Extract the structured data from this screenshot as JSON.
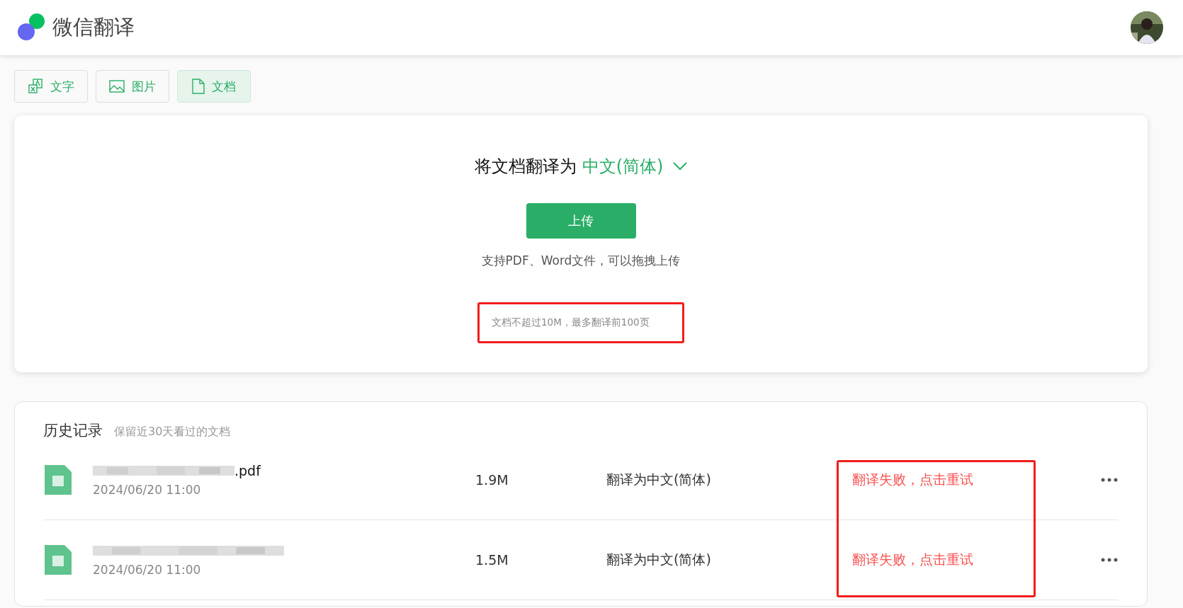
{
  "header": {
    "title": "微信翻译"
  },
  "tabs": [
    {
      "label": "文字",
      "kind": "text",
      "selected": false
    },
    {
      "label": "图片",
      "kind": "image",
      "selected": false
    },
    {
      "label": "文档",
      "kind": "document",
      "selected": true
    }
  ],
  "upload": {
    "prompt": "将文档翻译为",
    "language": "中文(简体)",
    "button": "上传",
    "hint": "支持PDF、Word文件，可以拖拽上传",
    "note": "文档不超过10M，最多翻译前100页"
  },
  "history": {
    "title": "历史记录",
    "subtitle": "保留近30天看过的文档",
    "rows": [
      {
        "name_visible": ".pdf",
        "date": "2024/06/20 11:00",
        "size": "1.9M",
        "target": "翻译为中文(简体)",
        "status": "翻译失败，点击重试"
      },
      {
        "date": "2024/06/20 11:00",
        "size": "1.5M",
        "target": "翻译为中文(简体)",
        "status": "翻译失败，点击重试"
      }
    ]
  }
}
